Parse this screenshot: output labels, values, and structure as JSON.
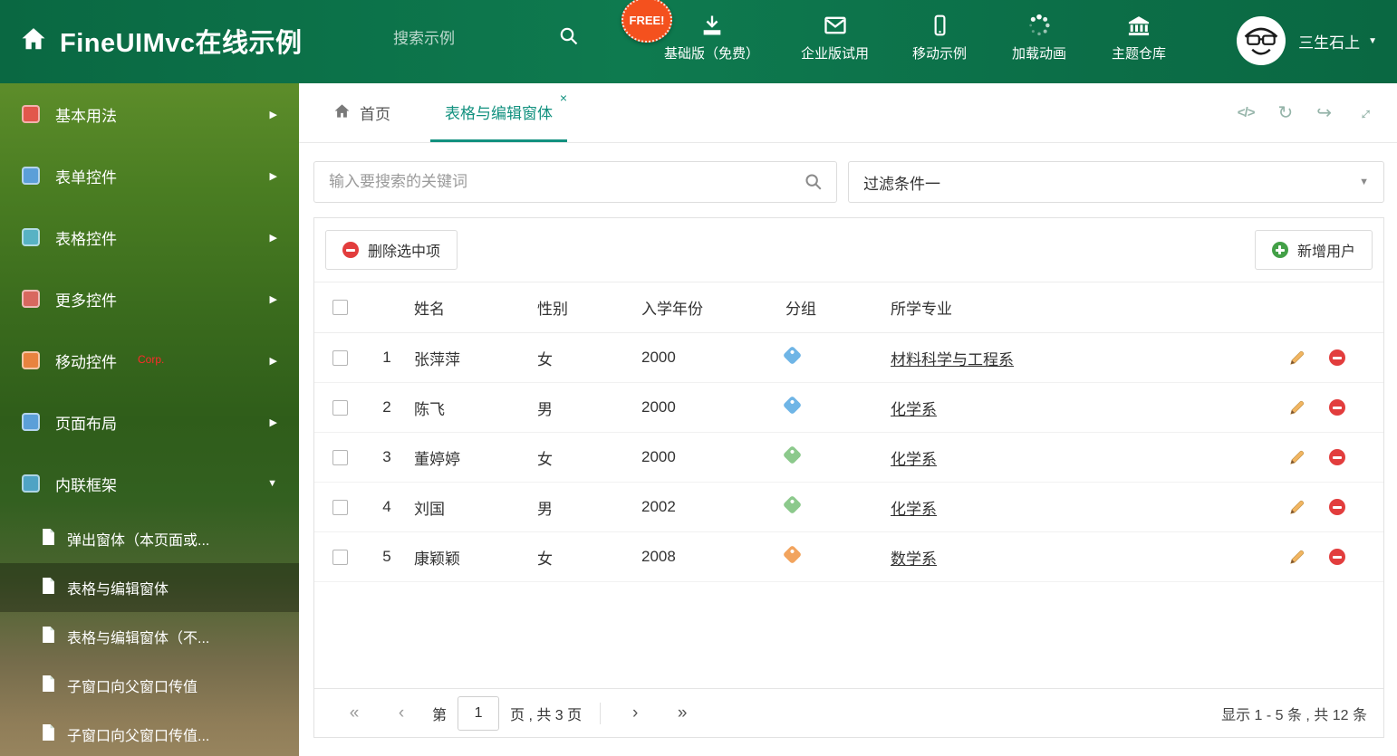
{
  "glyphs": {
    "code": "</>",
    "refresh": "↻",
    "share": "↪",
    "expand": "↔",
    "close": "×",
    "caret_down": "▼",
    "arrow_right": "▶",
    "first": "«",
    "prev": "‹",
    "next": "›",
    "last": "»"
  },
  "colors": {
    "header_green": "#0d7a4f",
    "tab_active_teal": "#12917f",
    "tag_blue": "#6fb5e6",
    "tag_green": "#8cc98c",
    "tag_orange": "#f2a45e",
    "danger_red": "#e23d3d",
    "success_green": "#43a047",
    "free_badge_orange": "#f4511e"
  },
  "header": {
    "title": "FineUIMvc在线示例",
    "search_placeholder": "搜索示例",
    "free_badge": "FREE!",
    "nav_items": [
      {
        "label": "基础版（免费）",
        "icon": "download-icon"
      },
      {
        "label": "企业版试用",
        "icon": "envelope-icon"
      },
      {
        "label": "移动示例",
        "icon": "mobile-icon"
      },
      {
        "label": "加载动画",
        "icon": "spinner-icon"
      },
      {
        "label": "主题仓库",
        "icon": "bank-icon"
      }
    ],
    "username": "三生石上"
  },
  "sidebar": {
    "items": [
      {
        "label": "基本用法"
      },
      {
        "label": "表单控件"
      },
      {
        "label": "表格控件"
      },
      {
        "label": "更多控件"
      },
      {
        "label": "移动控件",
        "badge": "Corp."
      },
      {
        "label": "页面布局"
      },
      {
        "label": "内联框架"
      }
    ],
    "subitems": [
      {
        "label": "弹出窗体（本页面或..."
      },
      {
        "label": "表格与编辑窗体"
      },
      {
        "label": "表格与编辑窗体（不..."
      },
      {
        "label": "子窗口向父窗口传值"
      },
      {
        "label": "子窗口向父窗口传值..."
      }
    ]
  },
  "tabs": {
    "home_label": "首页",
    "active_label": "表格与编辑窗体"
  },
  "filters": {
    "search_placeholder": "输入要搜索的关键词",
    "filter_value": "过滤条件一"
  },
  "toolbar": {
    "delete_label": "删除选中项",
    "add_label": "新增用户"
  },
  "table": {
    "columns": [
      "姓名",
      "性别",
      "入学年份",
      "分组",
      "所学专业"
    ],
    "rows": [
      {
        "num": "1",
        "name": "张萍萍",
        "gender": "女",
        "year": "2000",
        "tag": "blue",
        "major": "材料科学与工程系"
      },
      {
        "num": "2",
        "name": "陈飞",
        "gender": "男",
        "year": "2000",
        "tag": "blue",
        "major": "化学系"
      },
      {
        "num": "3",
        "name": "董婷婷",
        "gender": "女",
        "year": "2000",
        "tag": "green",
        "major": "化学系"
      },
      {
        "num": "4",
        "name": "刘国",
        "gender": "男",
        "year": "2002",
        "tag": "green",
        "major": "化学系"
      },
      {
        "num": "5",
        "name": "康颖颖",
        "gender": "女",
        "year": "2008",
        "tag": "orange",
        "major": "数学系"
      }
    ]
  },
  "pagination": {
    "page_prefix": "第",
    "current_page": "1",
    "page_suffix": "页 , 共 3 页",
    "summary": "显示 1 - 5 条 , 共 12 条"
  }
}
